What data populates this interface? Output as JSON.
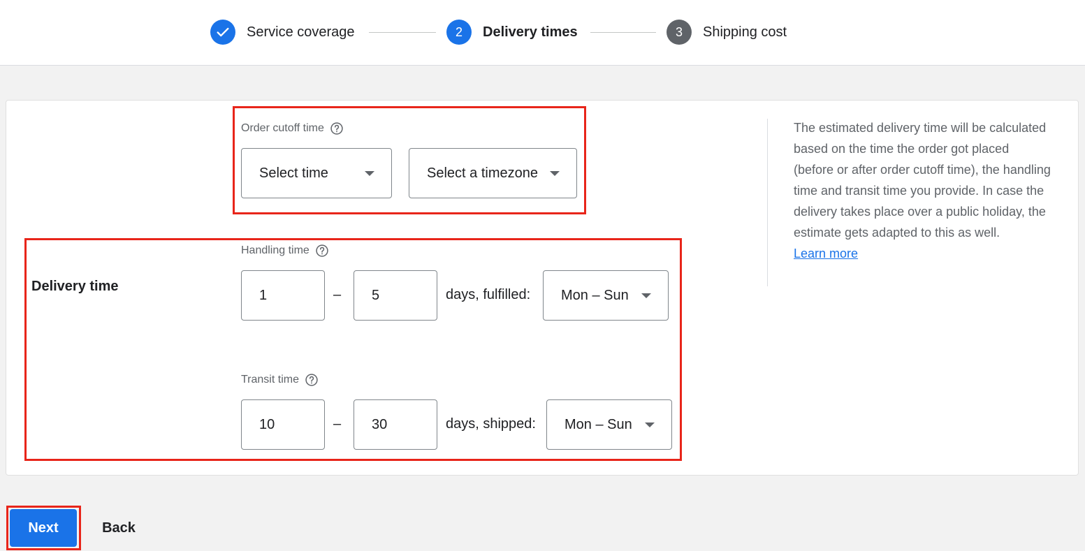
{
  "stepper": {
    "steps": [
      {
        "number": "",
        "label": "Service coverage",
        "state": "completed"
      },
      {
        "number": "2",
        "label": "Delivery times",
        "state": "active"
      },
      {
        "number": "3",
        "label": "Shipping cost",
        "state": "upcoming"
      }
    ]
  },
  "cutoff": {
    "label": "Order cutoff time",
    "time_select": "Select time",
    "timezone_select": "Select a timezone"
  },
  "delivery": {
    "section_title": "Delivery time",
    "handling": {
      "label": "Handling time",
      "min": "1",
      "max": "5",
      "separator": "–",
      "suffix": "days, fulfilled:",
      "days_select": "Mon – Sun"
    },
    "transit": {
      "label": "Transit time",
      "min": "10",
      "max": "30",
      "separator": "–",
      "suffix": "days, shipped:",
      "days_select": "Mon – Sun"
    }
  },
  "sidebar": {
    "info_text": "The estimated delivery time will be calculated based on the time the order got placed (before or after order cutoff time), the handling time and transit time you provide. In case the delivery takes place over a public holiday, the estimate gets adapted to this as well.",
    "link_text": "Learn more"
  },
  "actions": {
    "next_label": "Next",
    "back_label": "Back"
  },
  "colors": {
    "primary": "#1a73e8",
    "upcoming_step": "#5f6368",
    "highlight": "#e8251a"
  }
}
